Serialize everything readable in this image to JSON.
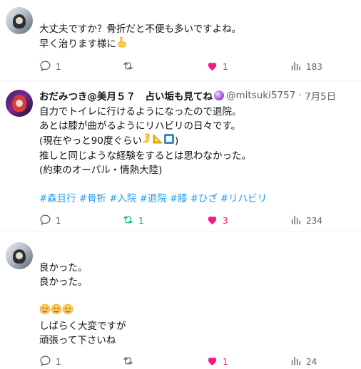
{
  "tweets": [
    {
      "lines": [
        "大丈夫ですか？骨折だと不便も多いですよね。",
        "早く治ります様に"
      ],
      "emoji_after_line2": "☝",
      "replies": "1",
      "retweets": "",
      "likes": "1",
      "views": "183"
    },
    {
      "display_name": "おだみつき@美月５７　占い垢も見てね",
      "handle": "@mitsuki5757",
      "date": "7月5日",
      "lines": [
        "自力でトイレに行けるようになったので退院。",
        "あとは膝が曲がるようにリハビリの日々です。",
        "(現在やっと90度ぐらい",
        "推しと同じような経験をするとは思わなかった。",
        "(約束のオーパル・情熱大陸)"
      ],
      "line3_suffix": ")",
      "hashtags": [
        "#森且行",
        "#骨折",
        "#入院",
        "#退院",
        "#膝",
        "#ひざ",
        "#リハビリ"
      ],
      "replies": "1",
      "retweets": "1",
      "likes": "3",
      "views": "234"
    },
    {
      "lines": [
        "良かった。",
        "良かった。",
        "",
        "",
        "しばらく大変ですが",
        "頑張って下さいね"
      ],
      "emoji_row": "☺☺☺",
      "replies": "1",
      "retweets": "",
      "likes": "1",
      "views": "24"
    }
  ],
  "colors": {
    "accent": "#1d9bf0",
    "like": "#f91880",
    "retweet": "#00ba7c",
    "muted": "#536471"
  }
}
